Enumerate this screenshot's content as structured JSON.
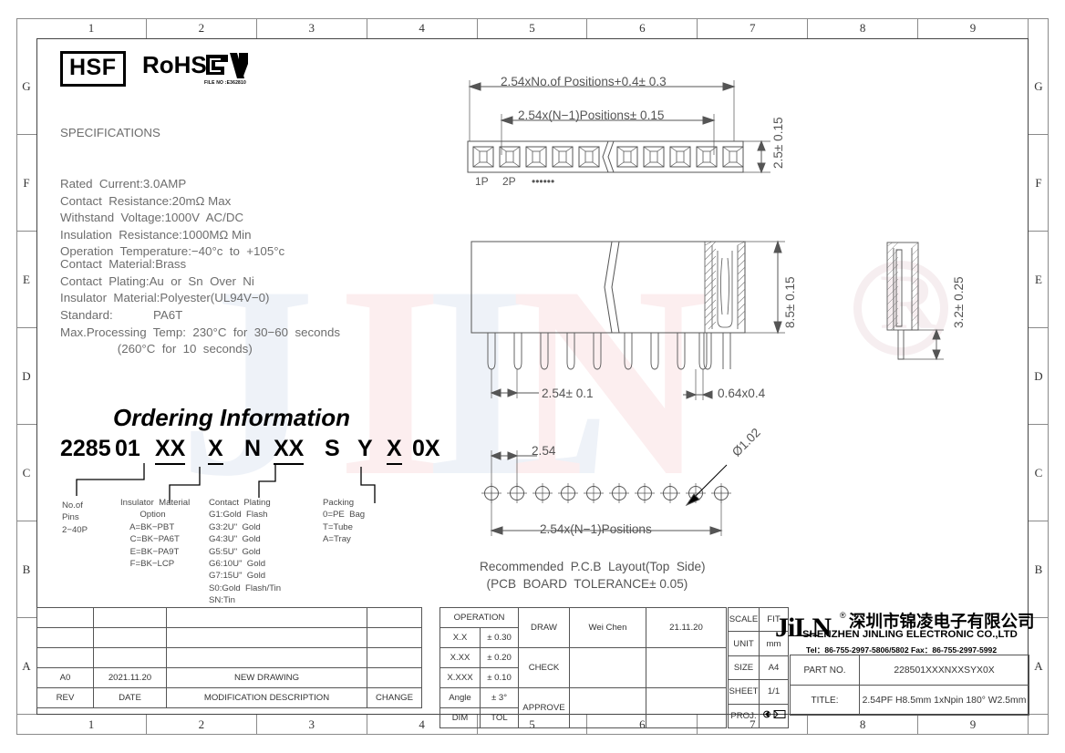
{
  "frame": {
    "columns": [
      "1",
      "2",
      "3",
      "4",
      "5",
      "6",
      "7",
      "8",
      "9"
    ],
    "rows": [
      "G",
      "F",
      "E",
      "D",
      "C",
      "B",
      "A"
    ]
  },
  "compliance": {
    "hsf": "HSF",
    "rohs": "RoHS",
    "ul_file": "FILE NO :E362810"
  },
  "specifications": {
    "heading": "SPECIFICATIONS",
    "lines": [
      "Rated  Current:3.0AMP",
      "Contact  Resistance:20mΩ Max",
      "Withstand  Voltage:1000V  AC/DC",
      "Insulation  Resistance:1000MΩ Min",
      "Operation  Temperature:−40°c  to  +105°c"
    ]
  },
  "materials": {
    "lines": [
      "Contact  Material:Brass",
      "Contact  Plating:Au  or  Sn  Over  Ni",
      "Insulator  Material:Polyester(UL94V−0)",
      "Standard:            PA6T",
      "Max.Processing  Temp:  230°C  for  30−60  seconds",
      "                 (260°C  for  10  seconds)"
    ]
  },
  "ordering": {
    "title": "Ordering Information",
    "part_segments": [
      "2285",
      "01",
      "XX",
      "X",
      "N",
      "XX",
      "S",
      "Y",
      "X",
      "0X"
    ],
    "callouts": {
      "pins": "No.of\nPins\n2−40P",
      "insulator": "Insulator  Material\n        Option\n    A=BK−PBT\n    C=BK−PA6T\n    E=BK−PA9T\n    F=BK−LCP",
      "plating": "Contact  Plating\nG1:Gold  Flash\nG3:2U\"  Gold\nG4:3U\"  Gold\nG5:5U\"  Gold\nG6:10U\"  Gold\nG7:15U\"  Gold\nS0:Gold  Flash/Tin\nSN:Tin",
      "packing": "Packing\n0=PE  Bag\nT=Tube\nA=Tray"
    }
  },
  "drawing": {
    "top_view": {
      "dim_overall": "2.54xNo.of  Positions+0.4± 0.3",
      "dim_pitch_total": "2.54x(N−1)Positions± 0.15",
      "dim_height": "2.5± 0.15",
      "pin_labels": [
        "1P",
        "2P",
        "••••••"
      ]
    },
    "front_view": {
      "dim_height": "8.5± 0.15",
      "dim_pitch": "2.54± 0.1",
      "dim_pin": "0.64x0.4"
    },
    "side_view": {
      "dim_depth": "3.2± 0.25"
    },
    "pcb": {
      "dim_pitch": "2.54",
      "dim_span": "2.54x(N−1)Positions",
      "dim_hole": "Ø1.02",
      "caption": "Recommended  P.C.B  Layout(Top  Side)\n  (PCB  BOARD  TOLERANCE± 0.05)"
    }
  },
  "revision_table": {
    "headers": [
      "REV",
      "DATE",
      "MODIFICATION  DESCRIPTION",
      "CHANGE"
    ],
    "rows": [
      {
        "rev": "A0",
        "date": "2021.11.20",
        "description": "NEW  DRAWING",
        "change": ""
      },
      {
        "rev": "",
        "date": "",
        "description": "",
        "change": ""
      },
      {
        "rev": "",
        "date": "",
        "description": "",
        "change": ""
      },
      {
        "rev": "",
        "date": "",
        "description": "",
        "change": ""
      }
    ]
  },
  "tolerance_table": {
    "title": "OPERATION",
    "headers": [
      "DIM",
      "TOL"
    ],
    "rows": [
      {
        "dim": "X.X",
        "tol": "± 0.30"
      },
      {
        "dim": "X.XX",
        "tol": "± 0.20"
      },
      {
        "dim": "X.XXX",
        "tol": "± 0.10"
      },
      {
        "dim": "Angle",
        "tol": "± 3°"
      }
    ]
  },
  "approval_table": {
    "rows": [
      {
        "role": "DRAW",
        "name": "Wei  Chen",
        "date": "21.11.20"
      },
      {
        "role": "CHECK",
        "name": "",
        "date": ""
      },
      {
        "role": "APPROVE",
        "name": "",
        "date": ""
      }
    ]
  },
  "meta_table": {
    "rows": [
      {
        "key": "SCALE",
        "value": "FIT"
      },
      {
        "key": "UNIT",
        "value": "mm"
      },
      {
        "key": "SIZE",
        "value": "A4"
      },
      {
        "key": "SHEET",
        "value": "1/1"
      },
      {
        "key": "PROJ.",
        "value": ""
      }
    ]
  },
  "company": {
    "logo": "JiLN",
    "registered": "®",
    "name_cn": "深圳市锦凌电子有限公司",
    "name_en": "SHENZHEN JINLING ELECTRONIC CO.,LTD",
    "contact": "Tel：86-755-2997-5806/5802     Fax：86-755-2997-5992"
  },
  "title_block": {
    "part_no_label": "PART  NO.",
    "part_no_value": "228501XXXNXXSYX0X",
    "title_label": "TITLE:",
    "title_value": "2.54PF  H8.5mm  1xNpin  180°  W2.5mm"
  }
}
